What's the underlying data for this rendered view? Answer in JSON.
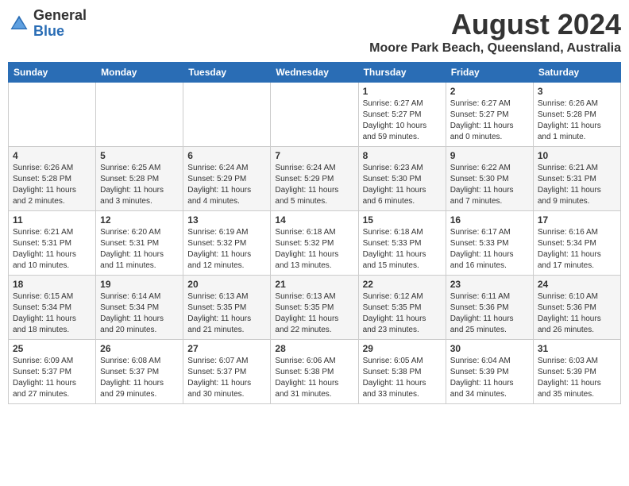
{
  "logo": {
    "general": "General",
    "blue": "Blue"
  },
  "header": {
    "month": "August 2024",
    "location": "Moore Park Beach, Queensland, Australia"
  },
  "days_of_week": [
    "Sunday",
    "Monday",
    "Tuesday",
    "Wednesday",
    "Thursday",
    "Friday",
    "Saturday"
  ],
  "weeks": [
    [
      {
        "day": "",
        "info": ""
      },
      {
        "day": "",
        "info": ""
      },
      {
        "day": "",
        "info": ""
      },
      {
        "day": "",
        "info": ""
      },
      {
        "day": "1",
        "info": "Sunrise: 6:27 AM\nSunset: 5:27 PM\nDaylight: 10 hours and 59 minutes."
      },
      {
        "day": "2",
        "info": "Sunrise: 6:27 AM\nSunset: 5:27 PM\nDaylight: 11 hours and 0 minutes."
      },
      {
        "day": "3",
        "info": "Sunrise: 6:26 AM\nSunset: 5:28 PM\nDaylight: 11 hours and 1 minute."
      }
    ],
    [
      {
        "day": "4",
        "info": "Sunrise: 6:26 AM\nSunset: 5:28 PM\nDaylight: 11 hours and 2 minutes."
      },
      {
        "day": "5",
        "info": "Sunrise: 6:25 AM\nSunset: 5:28 PM\nDaylight: 11 hours and 3 minutes."
      },
      {
        "day": "6",
        "info": "Sunrise: 6:24 AM\nSunset: 5:29 PM\nDaylight: 11 hours and 4 minutes."
      },
      {
        "day": "7",
        "info": "Sunrise: 6:24 AM\nSunset: 5:29 PM\nDaylight: 11 hours and 5 minutes."
      },
      {
        "day": "8",
        "info": "Sunrise: 6:23 AM\nSunset: 5:30 PM\nDaylight: 11 hours and 6 minutes."
      },
      {
        "day": "9",
        "info": "Sunrise: 6:22 AM\nSunset: 5:30 PM\nDaylight: 11 hours and 7 minutes."
      },
      {
        "day": "10",
        "info": "Sunrise: 6:21 AM\nSunset: 5:31 PM\nDaylight: 11 hours and 9 minutes."
      }
    ],
    [
      {
        "day": "11",
        "info": "Sunrise: 6:21 AM\nSunset: 5:31 PM\nDaylight: 11 hours and 10 minutes."
      },
      {
        "day": "12",
        "info": "Sunrise: 6:20 AM\nSunset: 5:31 PM\nDaylight: 11 hours and 11 minutes."
      },
      {
        "day": "13",
        "info": "Sunrise: 6:19 AM\nSunset: 5:32 PM\nDaylight: 11 hours and 12 minutes."
      },
      {
        "day": "14",
        "info": "Sunrise: 6:18 AM\nSunset: 5:32 PM\nDaylight: 11 hours and 13 minutes."
      },
      {
        "day": "15",
        "info": "Sunrise: 6:18 AM\nSunset: 5:33 PM\nDaylight: 11 hours and 15 minutes."
      },
      {
        "day": "16",
        "info": "Sunrise: 6:17 AM\nSunset: 5:33 PM\nDaylight: 11 hours and 16 minutes."
      },
      {
        "day": "17",
        "info": "Sunrise: 6:16 AM\nSunset: 5:34 PM\nDaylight: 11 hours and 17 minutes."
      }
    ],
    [
      {
        "day": "18",
        "info": "Sunrise: 6:15 AM\nSunset: 5:34 PM\nDaylight: 11 hours and 18 minutes."
      },
      {
        "day": "19",
        "info": "Sunrise: 6:14 AM\nSunset: 5:34 PM\nDaylight: 11 hours and 20 minutes."
      },
      {
        "day": "20",
        "info": "Sunrise: 6:13 AM\nSunset: 5:35 PM\nDaylight: 11 hours and 21 minutes."
      },
      {
        "day": "21",
        "info": "Sunrise: 6:13 AM\nSunset: 5:35 PM\nDaylight: 11 hours and 22 minutes."
      },
      {
        "day": "22",
        "info": "Sunrise: 6:12 AM\nSunset: 5:35 PM\nDaylight: 11 hours and 23 minutes."
      },
      {
        "day": "23",
        "info": "Sunrise: 6:11 AM\nSunset: 5:36 PM\nDaylight: 11 hours and 25 minutes."
      },
      {
        "day": "24",
        "info": "Sunrise: 6:10 AM\nSunset: 5:36 PM\nDaylight: 11 hours and 26 minutes."
      }
    ],
    [
      {
        "day": "25",
        "info": "Sunrise: 6:09 AM\nSunset: 5:37 PM\nDaylight: 11 hours and 27 minutes."
      },
      {
        "day": "26",
        "info": "Sunrise: 6:08 AM\nSunset: 5:37 PM\nDaylight: 11 hours and 29 minutes."
      },
      {
        "day": "27",
        "info": "Sunrise: 6:07 AM\nSunset: 5:37 PM\nDaylight: 11 hours and 30 minutes."
      },
      {
        "day": "28",
        "info": "Sunrise: 6:06 AM\nSunset: 5:38 PM\nDaylight: 11 hours and 31 minutes."
      },
      {
        "day": "29",
        "info": "Sunrise: 6:05 AM\nSunset: 5:38 PM\nDaylight: 11 hours and 33 minutes."
      },
      {
        "day": "30",
        "info": "Sunrise: 6:04 AM\nSunset: 5:39 PM\nDaylight: 11 hours and 34 minutes."
      },
      {
        "day": "31",
        "info": "Sunrise: 6:03 AM\nSunset: 5:39 PM\nDaylight: 11 hours and 35 minutes."
      }
    ]
  ]
}
